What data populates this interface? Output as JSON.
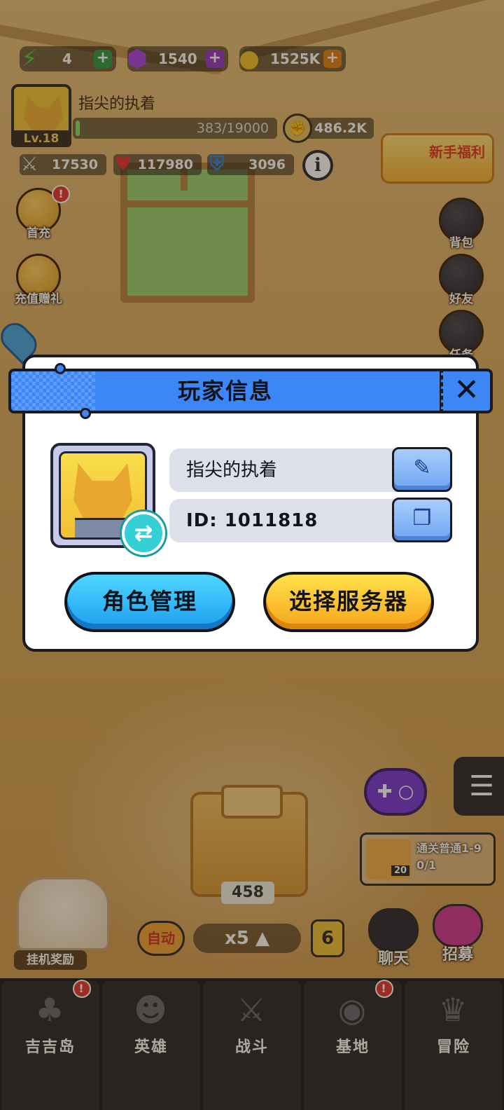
{
  "resources": {
    "energy": {
      "value": "4",
      "icon": "lightning-icon"
    },
    "gems": {
      "value": "1540",
      "icon": "gem-icon"
    },
    "coins": {
      "value": "1525K",
      "icon": "coin-icon"
    },
    "plus": "+"
  },
  "player_hud": {
    "name": "指尖的执着",
    "level": "Lv.18",
    "xp": "383/19000",
    "xp_fraction": 0.02,
    "power": "486.2K",
    "attack": "17530",
    "hp": "117980",
    "defense": "3096",
    "info": "i"
  },
  "newbie_event": {
    "label": "新手福利"
  },
  "side_menu_left": [
    {
      "label": "首充",
      "badge": "!"
    },
    {
      "label": "充值赠礼"
    }
  ],
  "side_menu_right": [
    {
      "label": "背包"
    },
    {
      "label": "好友"
    },
    {
      "label": "任务"
    }
  ],
  "modal": {
    "title": "玩家信息",
    "close": "✕",
    "player_name": "指尖的执着",
    "player_id": "ID: 1011818",
    "edit_icon": "✎",
    "copy_icon": "❐",
    "swap_icon": "⇄",
    "role_button": "角色管理",
    "server_button": "选择服务器"
  },
  "scene": {
    "chest_count": "458",
    "quest": {
      "text_line1": "通关普通1-9",
      "text_line2": "0/1",
      "count": "20"
    },
    "afk_label": "挂机奖励",
    "auto_label": "自动",
    "speed_label": "x5 ▲",
    "wave_number": "6",
    "chat_label": "聊天",
    "recruit_label": "招募",
    "menu_icon": "☰"
  },
  "bottom_nav": [
    {
      "label": "吉吉岛",
      "icon": "palm-tree-icon",
      "glyph": "♣",
      "badge": "!"
    },
    {
      "label": "英雄",
      "icon": "hero-icon",
      "glyph": "☻"
    },
    {
      "label": "战斗",
      "icon": "crossed-swords-icon",
      "glyph": "⚔"
    },
    {
      "label": "基地",
      "icon": "base-icon",
      "glyph": "◉",
      "badge": "!"
    },
    {
      "label": "冒险",
      "icon": "adventure-icon",
      "glyph": "♛"
    }
  ]
}
